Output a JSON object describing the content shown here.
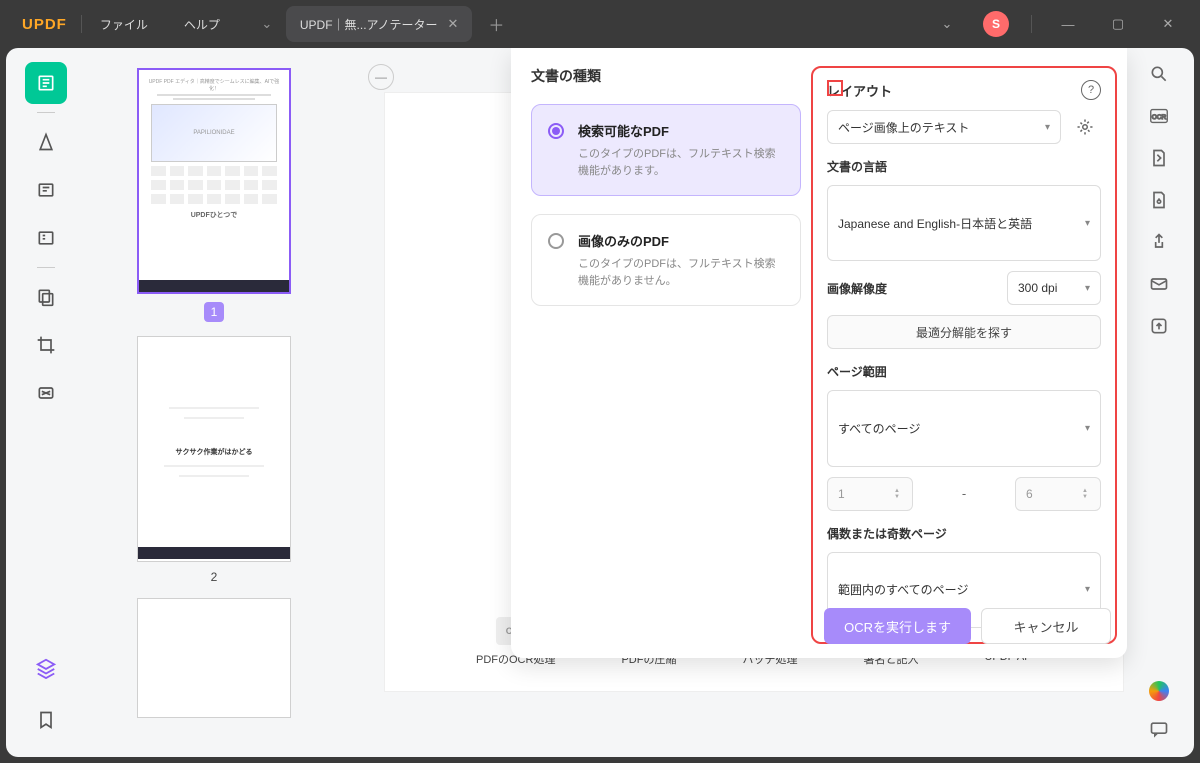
{
  "app": {
    "name": "UPDF",
    "user_initial": "S"
  },
  "menu": {
    "file": "ファイル",
    "help": "ヘルプ"
  },
  "tab": {
    "title": "UPDF｜無...アノテーター"
  },
  "thumbs": {
    "page1": {
      "num": "1",
      "hero": "PAPILIONIDAE",
      "header": "UPDF PDF エディタ｜高精度でシームレスに編集、AIで強化！",
      "foot": "UPDFひとつで"
    },
    "page2": {
      "num": "2",
      "title": "サクサク作業がはかどる"
    }
  },
  "tools": {
    "ocr": "PDFのOCR処理",
    "compress": "PDFの圧縮",
    "batch": "バッチ処理",
    "sign": "署名と記入",
    "ai": "UPDF AI",
    "ai_badge": "✦ UPDF AI"
  },
  "modal": {
    "doc_type_heading": "文書の種類",
    "opt1": {
      "title": "検索可能なPDF",
      "desc": "このタイプのPDFは、フルテキスト検索機能があります。"
    },
    "opt2": {
      "title": "画像のみのPDF",
      "desc": "このタイプのPDFは、フルテキスト検索機能がありません。"
    },
    "layout": {
      "heading": "レイアウト",
      "selected": "ページ画像上のテキスト"
    },
    "lang": {
      "heading": "文書の言語",
      "selected": "Japanese and English-日本語と英語"
    },
    "resolution": {
      "heading": "画像解像度",
      "selected": "300 dpi",
      "optimal_btn": "最適分解能を探す"
    },
    "page_range": {
      "heading": "ページ範囲",
      "selected": "すべてのページ",
      "from": "1",
      "to": "6"
    },
    "parity": {
      "heading": "偶数または奇数ページ",
      "selected": "範囲内のすべてのページ"
    },
    "actions": {
      "run": "OCRを実行します",
      "cancel": "キャンセル"
    }
  }
}
